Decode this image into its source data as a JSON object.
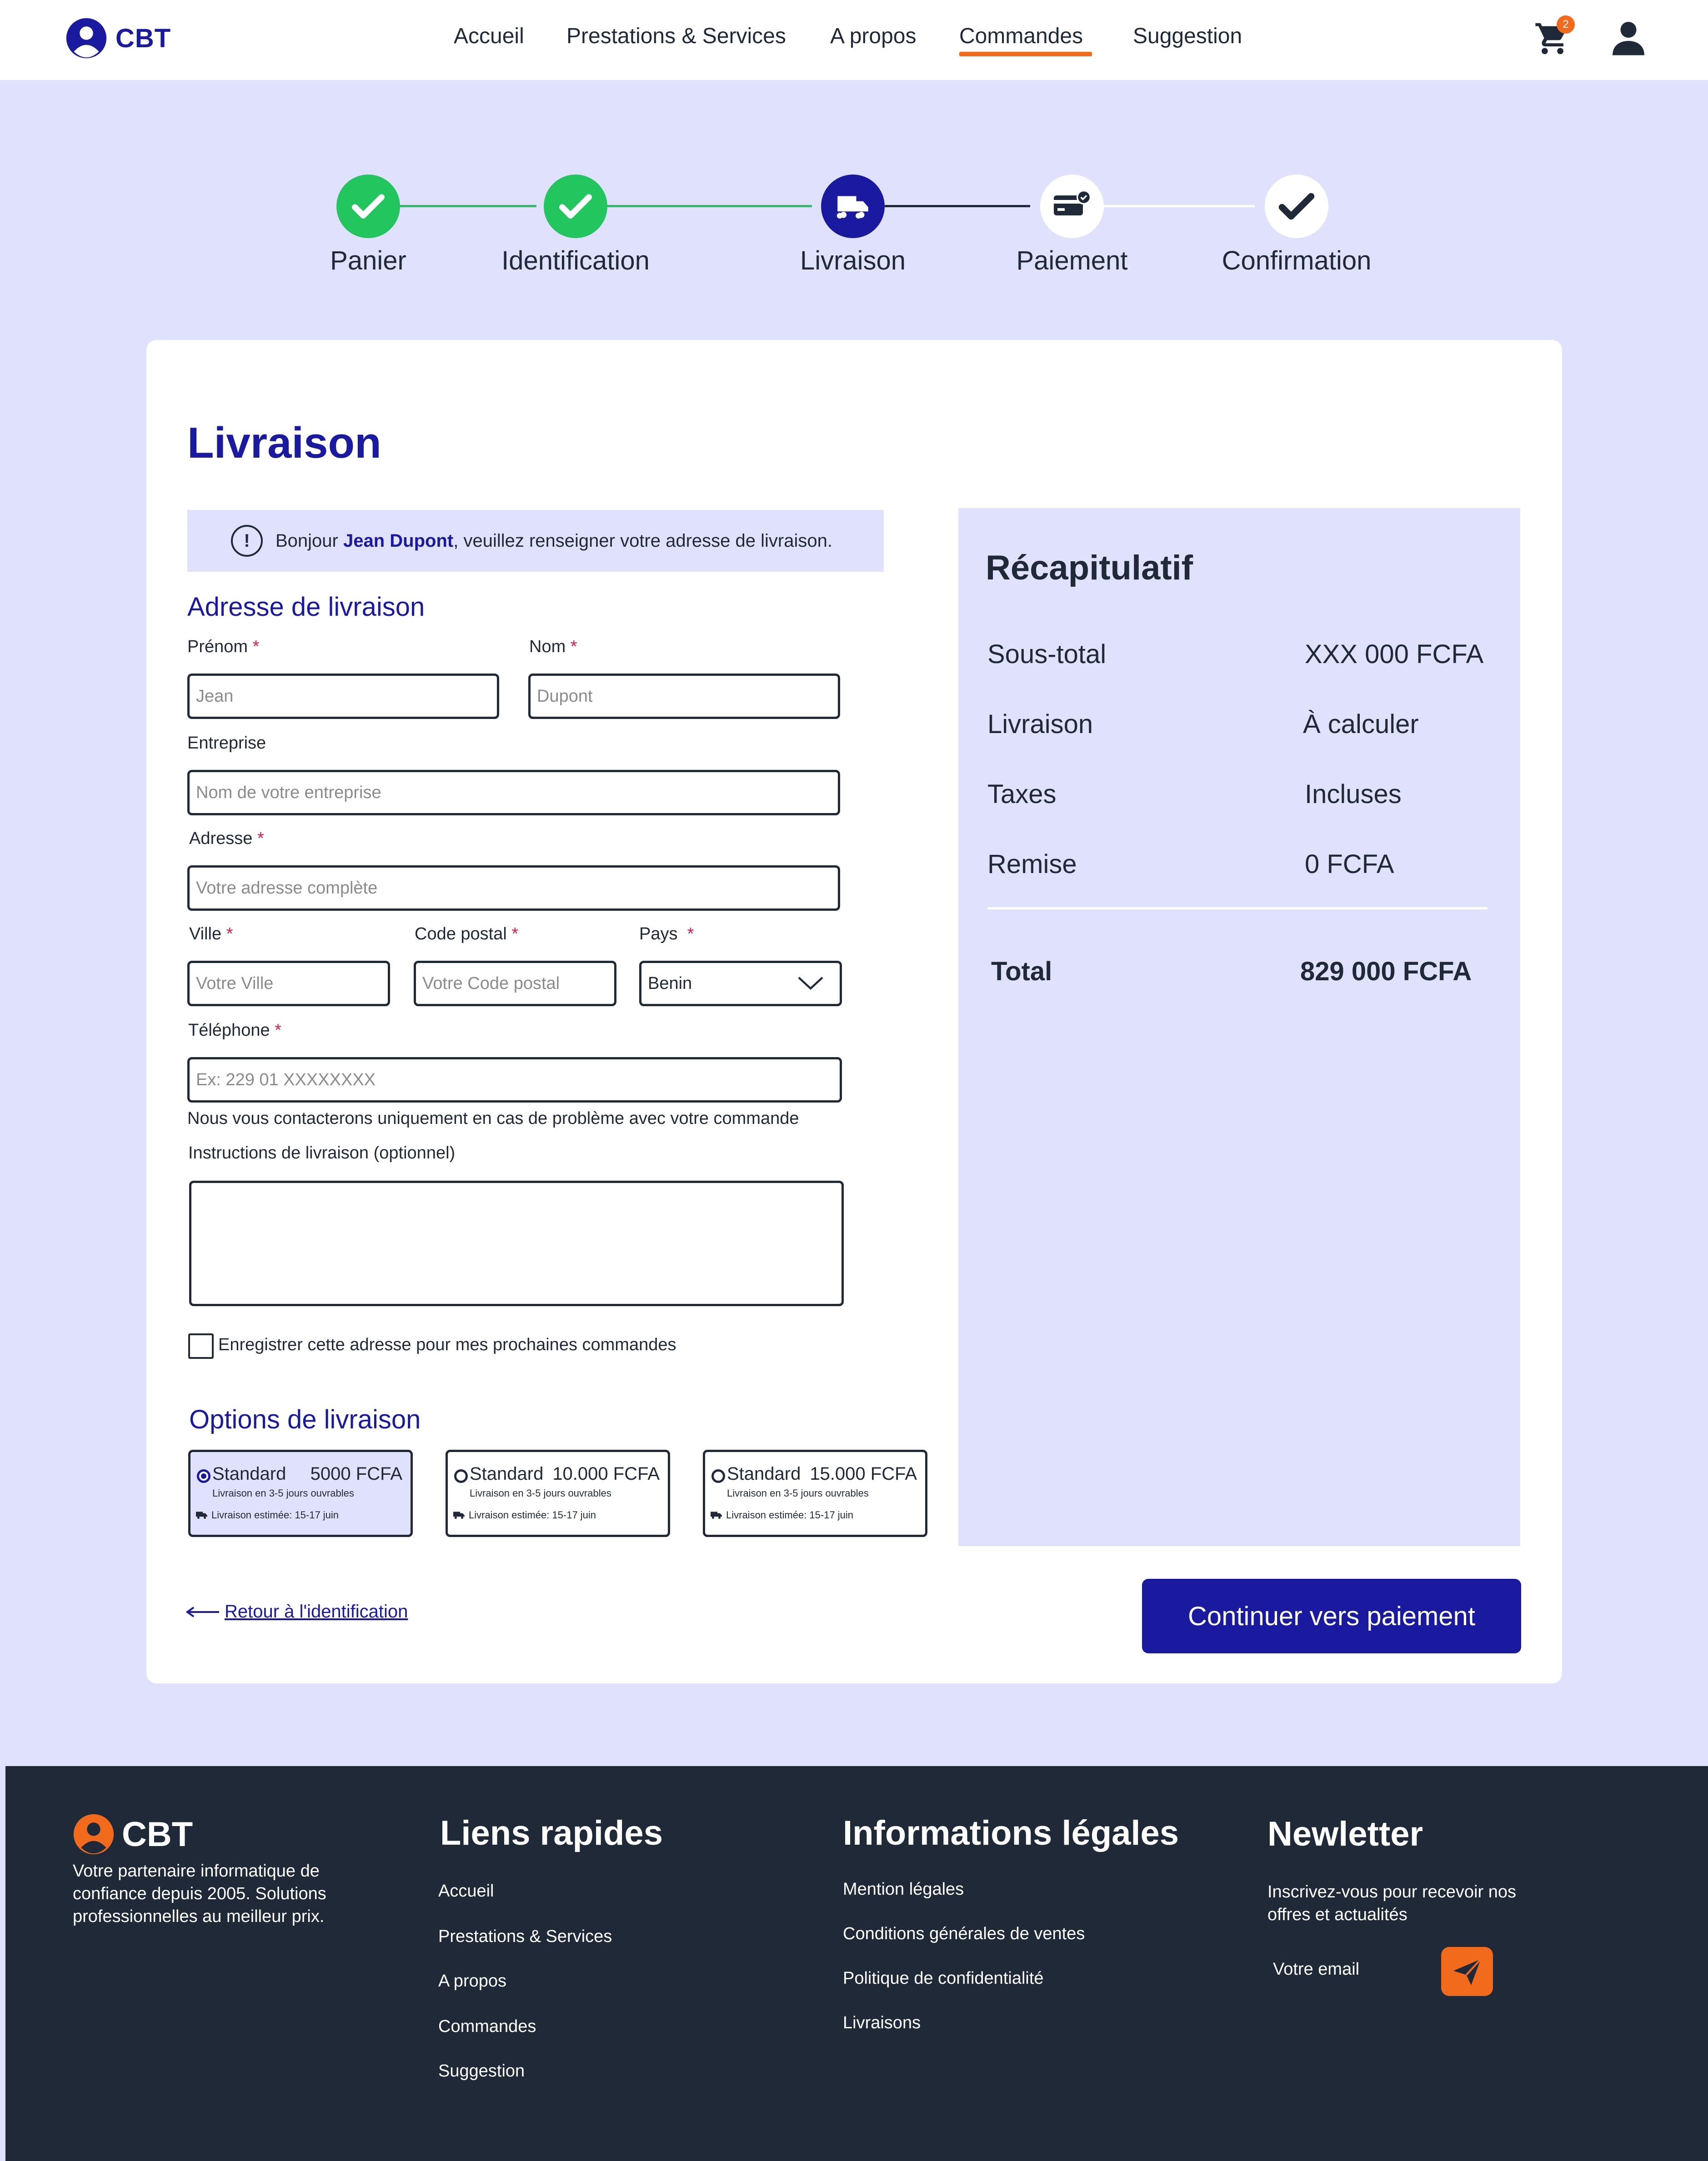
{
  "brand": {
    "name": "CBT",
    "primary_color": "#1a1aa0",
    "accent_color": "#f26b1d",
    "success_color": "#22c55e",
    "dark_color": "#1f2937",
    "light_bg": "#dfe1fd"
  },
  "header": {
    "nav": [
      {
        "label": "Accueil"
      },
      {
        "label": "Prestations & Services"
      },
      {
        "label": "A propos"
      },
      {
        "label": "Commandes",
        "active": true
      },
      {
        "label": "Suggestion"
      }
    ],
    "cart_count": "2",
    "cart_icon": "cart-icon",
    "user_icon": "user-icon"
  },
  "stepper": {
    "steps": [
      {
        "label": "Panier",
        "state": "done"
      },
      {
        "label": "Identification",
        "state": "done"
      },
      {
        "label": "Livraison",
        "state": "current"
      },
      {
        "label": "Paiement",
        "state": "upcoming"
      },
      {
        "label": "Confirmation",
        "state": "upcoming"
      }
    ]
  },
  "page": {
    "title": "Livraison",
    "info": {
      "prefix": "Bonjour ",
      "name": "Jean Dupont",
      "suffix": ", veuillez renseigner votre adresse de livraison."
    }
  },
  "form": {
    "section_title": "Adresse de livraison",
    "firstname": {
      "label": "Prénom",
      "placeholder": "Jean"
    },
    "lastname": {
      "label": "Nom",
      "placeholder": "Dupont"
    },
    "company": {
      "label": "Entreprise",
      "placeholder": "Nom de votre entreprise"
    },
    "address": {
      "label": "Adresse",
      "placeholder": "Votre adresse complète"
    },
    "city": {
      "label": "Ville",
      "placeholder": "Votre Ville"
    },
    "postal": {
      "label": "Code postal",
      "placeholder": "Votre Code postal"
    },
    "country": {
      "label": "Pays",
      "value": "Benin"
    },
    "phone": {
      "label": "Téléphone",
      "placeholder": "Ex: 229 01 XXXXXXXX",
      "hint": "Nous vous contacterons uniquement en cas de problème avec votre commande"
    },
    "instructions": {
      "label": "Instructions de livraison (optionnel)"
    },
    "save_address": "Enregistrer cette adresse pour mes prochaines commandes",
    "required_mark": "*"
  },
  "delivery": {
    "section_title": "Options de livraison",
    "options": [
      {
        "name": "Standard",
        "price": "5000 FCFA",
        "sub": "Livraison en 3-5 jours ouvrables",
        "estimate": "Livraison estimée: 15-17 juin",
        "selected": true
      },
      {
        "name": "Standard",
        "price": "10.000 FCFA",
        "sub": "Livraison en 3-5 jours ouvrables",
        "estimate": "Livraison estimée: 15-17 juin",
        "selected": false
      },
      {
        "name": "Standard",
        "price": "15.000 FCFA",
        "sub": "Livraison en 3-5 jours ouvrables",
        "estimate": "Livraison estimée: 15-17 juin",
        "selected": false
      }
    ]
  },
  "actions": {
    "back": "Retour à l'identification",
    "continue": "Continuer vers paiement"
  },
  "summary": {
    "title": "Récapitulatif",
    "rows": [
      {
        "label": "Sous-total",
        "value": "XXX 000 FCFA"
      },
      {
        "label": "Livraison",
        "value": "À calculer"
      },
      {
        "label": "Taxes",
        "value": "Incluses"
      },
      {
        "label": "Remise",
        "value": "0 FCFA"
      }
    ],
    "total_label": "Total",
    "total_value": "829 000 FCFA"
  },
  "footer": {
    "brand": "CBT",
    "description": "Votre partenaire informatique de confiance depuis 2005. Solutions professionnelles au meilleur prix.",
    "quick_links": {
      "title": "Liens rapides",
      "items": [
        "Accueil",
        "Prestations & Services",
        "A propos",
        "Commandes",
        "Suggestion"
      ]
    },
    "legal": {
      "title": "Informations légales",
      "items": [
        "Mention légales",
        "Conditions générales de ventes",
        "Politique de confidentialité",
        "Livraisons"
      ]
    },
    "newsletter": {
      "title": "Newletter",
      "text": "Inscrivez-vous pour recevoir nos offres et actualités",
      "placeholder": "Votre email",
      "send_icon": "send-icon"
    }
  }
}
